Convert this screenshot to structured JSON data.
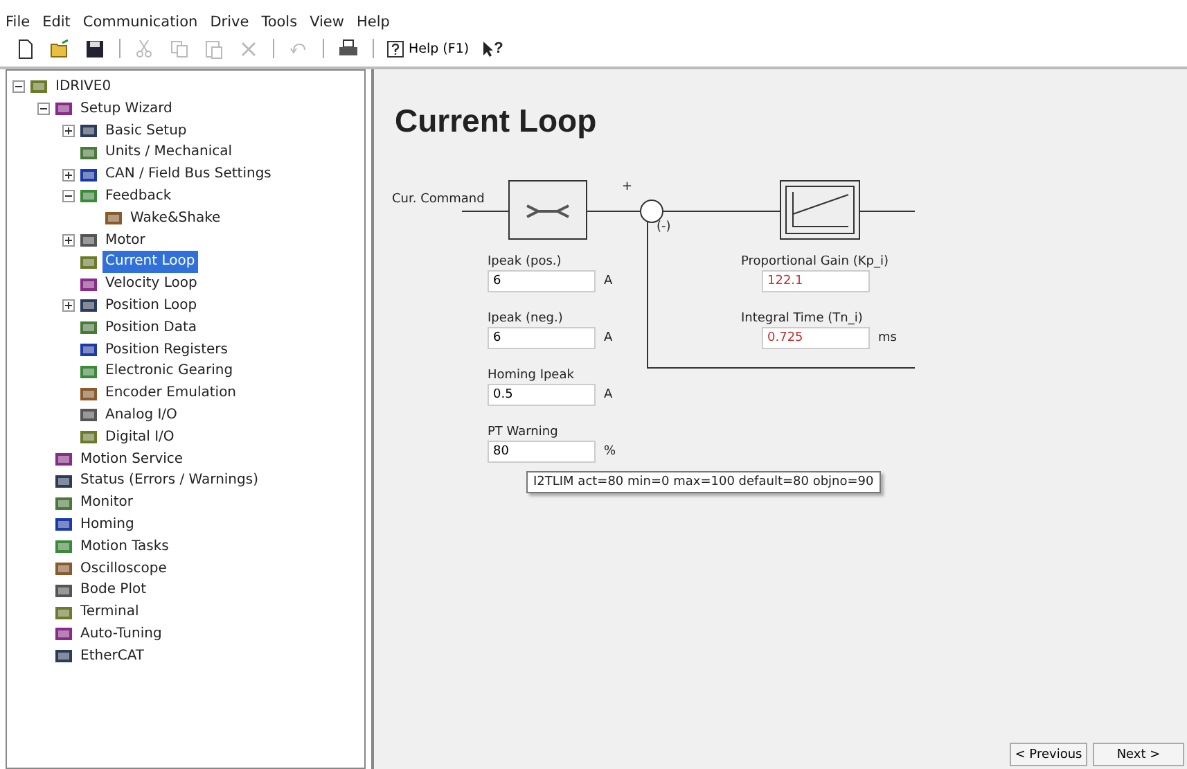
{
  "menu": [
    "File",
    "Edit",
    "Communication",
    "Drive",
    "Tools",
    "View",
    "Help"
  ],
  "toolbar": [
    {
      "kind": "new",
      "disabled": false
    },
    {
      "kind": "open",
      "disabled": false
    },
    {
      "kind": "save",
      "disabled": false
    },
    {
      "kind": "sep"
    },
    {
      "kind": "cut",
      "disabled": true
    },
    {
      "kind": "copy",
      "disabled": true
    },
    {
      "kind": "paste",
      "disabled": true
    },
    {
      "kind": "delete",
      "disabled": true
    },
    {
      "kind": "sep"
    },
    {
      "kind": "undo",
      "disabled": true
    },
    {
      "kind": "sep"
    },
    {
      "kind": "print",
      "disabled": false
    },
    {
      "kind": "sep"
    },
    {
      "kind": "help",
      "label": "Help (F1)"
    },
    {
      "kind": "whatsthis",
      "label": "?"
    }
  ],
  "tree": [
    {
      "label": "IDRIVE0",
      "expanded": true,
      "selected": false,
      "children": [
        {
          "label": "Setup Wizard",
          "expanded": true,
          "selected": false,
          "children": [
            {
              "label": "Basic Setup",
              "expanded": false,
              "selected": false
            },
            {
              "label": "Units / Mechanical",
              "selected": false
            },
            {
              "label": "CAN / Field Bus Settings",
              "expanded": false,
              "selected": false
            },
            {
              "label": "Feedback",
              "expanded": true,
              "selected": false,
              "children": [
                {
                  "label": "Wake&Shake",
                  "selected": false
                }
              ]
            },
            {
              "label": "Motor",
              "expanded": false,
              "selected": false
            },
            {
              "label": "Current Loop",
              "selected": true
            },
            {
              "label": "Velocity Loop",
              "selected": false
            },
            {
              "label": "Position Loop",
              "expanded": false,
              "selected": false
            },
            {
              "label": "Position Data",
              "selected": false
            },
            {
              "label": "Position Registers",
              "selected": false
            },
            {
              "label": "Electronic Gearing",
              "selected": false
            },
            {
              "label": "Encoder Emulation",
              "selected": false
            },
            {
              "label": "Analog I/O",
              "selected": false
            },
            {
              "label": "Digital I/O",
              "selected": false
            }
          ]
        },
        {
          "label": "Motion Service",
          "selected": false
        },
        {
          "label": "Status (Errors / Warnings)",
          "selected": false
        },
        {
          "label": "Monitor",
          "selected": false
        },
        {
          "label": "Homing",
          "selected": false
        },
        {
          "label": "Motion Tasks",
          "selected": false
        },
        {
          "label": "Oscilloscope",
          "selected": false
        },
        {
          "label": "Bode Plot",
          "selected": false
        },
        {
          "label": "Terminal",
          "selected": false
        },
        {
          "label": "Auto-Tuning",
          "selected": false
        },
        {
          "label": "EtherCAT",
          "selected": false
        }
      ]
    }
  ],
  "page": {
    "title": "Current Loop",
    "diagram": {
      "input_label": "Cur. Command",
      "plus": "+",
      "minus": "(-)"
    },
    "left_fields": [
      {
        "label": "Ipeak (pos.)",
        "value": "6",
        "unit": "A"
      },
      {
        "label": "Ipeak (neg.)",
        "value": "6",
        "unit": "A"
      },
      {
        "label": "Homing Ipeak",
        "value": "0.5",
        "unit": "A"
      },
      {
        "label": "PT Warning",
        "value": "80",
        "unit": "%"
      }
    ],
    "right_fields": [
      {
        "label": "Proportional Gain (Kp_i)",
        "value": "122.1"
      },
      {
        "label": "Integral Time (Tn_i)",
        "value": "0.725",
        "unit": "ms"
      }
    ],
    "tooltip": "I2TLIM act=80 min=0 max=100 default=80 objno=90",
    "buttons": [
      "< Previous",
      "Next >"
    ]
  }
}
